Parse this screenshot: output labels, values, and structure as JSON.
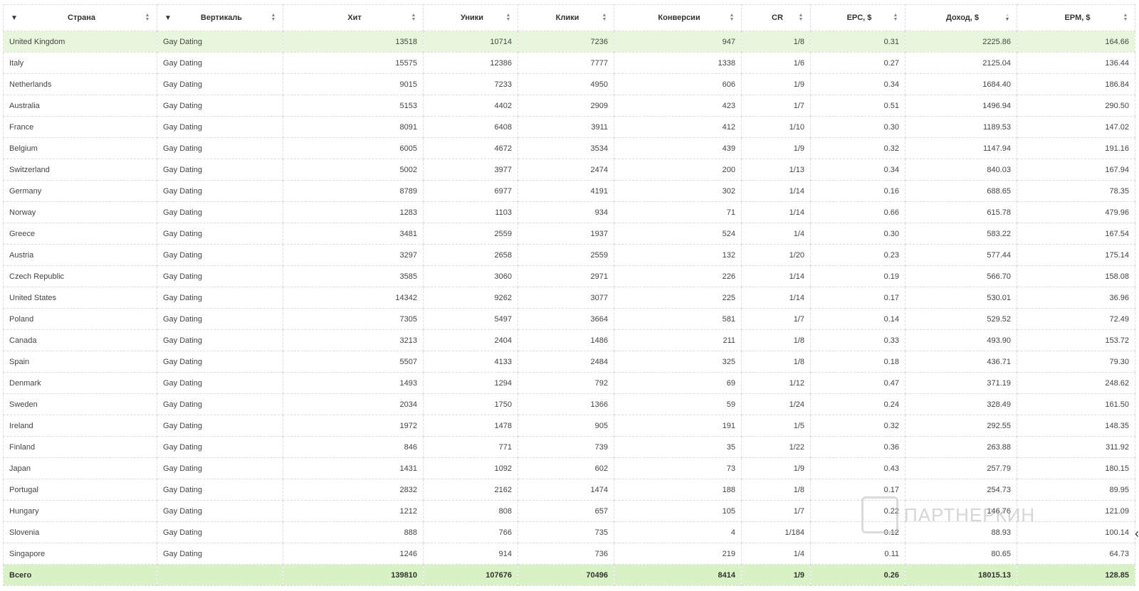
{
  "columns": [
    {
      "key": "country",
      "label": "Страна",
      "filter": true,
      "sort": "both"
    },
    {
      "key": "vertical",
      "label": "Вертикаль",
      "filter": true,
      "sort": "both"
    },
    {
      "key": "hits",
      "label": "Хит",
      "filter": false,
      "sort": "both"
    },
    {
      "key": "uniques",
      "label": "Уники",
      "filter": false,
      "sort": "both"
    },
    {
      "key": "clicks",
      "label": "Клики",
      "filter": false,
      "sort": "both"
    },
    {
      "key": "conversions",
      "label": "Конверсии",
      "filter": false,
      "sort": "both"
    },
    {
      "key": "cr",
      "label": "CR",
      "filter": false,
      "sort": "both"
    },
    {
      "key": "epc",
      "label": "EPC, $",
      "filter": false,
      "sort": "both"
    },
    {
      "key": "income",
      "label": "Доход, $",
      "filter": false,
      "sort": "desc"
    },
    {
      "key": "epm",
      "label": "EPM, $",
      "filter": false,
      "sort": "both"
    }
  ],
  "rows": [
    [
      "United Kingdom",
      "Gay Dating",
      "13518",
      "10714",
      "7236",
      "947",
      "1/8",
      "0.31",
      "2225.86",
      "164.66"
    ],
    [
      "Italy",
      "Gay Dating",
      "15575",
      "12386",
      "7777",
      "1338",
      "1/6",
      "0.27",
      "2125.04",
      "136.44"
    ],
    [
      "Netherlands",
      "Gay Dating",
      "9015",
      "7233",
      "4950",
      "606",
      "1/9",
      "0.34",
      "1684.40",
      "186.84"
    ],
    [
      "Australia",
      "Gay Dating",
      "5153",
      "4402",
      "2909",
      "423",
      "1/7",
      "0.51",
      "1496.94",
      "290.50"
    ],
    [
      "France",
      "Gay Dating",
      "8091",
      "6408",
      "3911",
      "412",
      "1/10",
      "0.30",
      "1189.53",
      "147.02"
    ],
    [
      "Belgium",
      "Gay Dating",
      "6005",
      "4672",
      "3534",
      "439",
      "1/9",
      "0.32",
      "1147.94",
      "191.16"
    ],
    [
      "Switzerland",
      "Gay Dating",
      "5002",
      "3977",
      "2474",
      "200",
      "1/13",
      "0.34",
      "840.03",
      "167.94"
    ],
    [
      "Germany",
      "Gay Dating",
      "8789",
      "6977",
      "4191",
      "302",
      "1/14",
      "0.16",
      "688.65",
      "78.35"
    ],
    [
      "Norway",
      "Gay Dating",
      "1283",
      "1103",
      "934",
      "71",
      "1/14",
      "0.66",
      "615.78",
      "479.96"
    ],
    [
      "Greece",
      "Gay Dating",
      "3481",
      "2559",
      "1937",
      "524",
      "1/4",
      "0.30",
      "583.22",
      "167.54"
    ],
    [
      "Austria",
      "Gay Dating",
      "3297",
      "2658",
      "2559",
      "132",
      "1/20",
      "0.23",
      "577.44",
      "175.14"
    ],
    [
      "Czech Republic",
      "Gay Dating",
      "3585",
      "3060",
      "2971",
      "226",
      "1/14",
      "0.19",
      "566.70",
      "158.08"
    ],
    [
      "United States",
      "Gay Dating",
      "14342",
      "9262",
      "3077",
      "225",
      "1/14",
      "0.17",
      "530.01",
      "36.96"
    ],
    [
      "Poland",
      "Gay Dating",
      "7305",
      "5497",
      "3664",
      "581",
      "1/7",
      "0.14",
      "529.52",
      "72.49"
    ],
    [
      "Canada",
      "Gay Dating",
      "3213",
      "2404",
      "1486",
      "211",
      "1/8",
      "0.33",
      "493.90",
      "153.72"
    ],
    [
      "Spain",
      "Gay Dating",
      "5507",
      "4133",
      "2484",
      "325",
      "1/8",
      "0.18",
      "436.71",
      "79.30"
    ],
    [
      "Denmark",
      "Gay Dating",
      "1493",
      "1294",
      "792",
      "69",
      "1/12",
      "0.47",
      "371.19",
      "248.62"
    ],
    [
      "Sweden",
      "Gay Dating",
      "2034",
      "1750",
      "1366",
      "59",
      "1/24",
      "0.24",
      "328.49",
      "161.50"
    ],
    [
      "Ireland",
      "Gay Dating",
      "1972",
      "1478",
      "905",
      "191",
      "1/5",
      "0.32",
      "292.55",
      "148.35"
    ],
    [
      "Finland",
      "Gay Dating",
      "846",
      "771",
      "739",
      "35",
      "1/22",
      "0.36",
      "263.88",
      "311.92"
    ],
    [
      "Japan",
      "Gay Dating",
      "1431",
      "1092",
      "602",
      "73",
      "1/9",
      "0.43",
      "257.79",
      "180.15"
    ],
    [
      "Portugal",
      "Gay Dating",
      "2832",
      "2162",
      "1474",
      "188",
      "1/8",
      "0.17",
      "254.73",
      "89.95"
    ],
    [
      "Hungary",
      "Gay Dating",
      "1212",
      "808",
      "657",
      "105",
      "1/7",
      "0.22",
      "146.76",
      "121.09"
    ],
    [
      "Slovenia",
      "Gay Dating",
      "888",
      "766",
      "735",
      "4",
      "1/184",
      "0.12",
      "88.93",
      "100.14"
    ],
    [
      "Singapore",
      "Gay Dating",
      "1246",
      "914",
      "736",
      "219",
      "1/4",
      "0.11",
      "80.65",
      "64.73"
    ]
  ],
  "total": [
    "Всего",
    "",
    "139810",
    "107676",
    "70496",
    "8414",
    "1/9",
    "0.26",
    "18015.13",
    "128.85"
  ],
  "watermark": "ПАРТНЕРКИН",
  "colors": {
    "highlight": "#e8f7dc",
    "total": "#d9f2c5",
    "border": "#dcdcdc"
  }
}
